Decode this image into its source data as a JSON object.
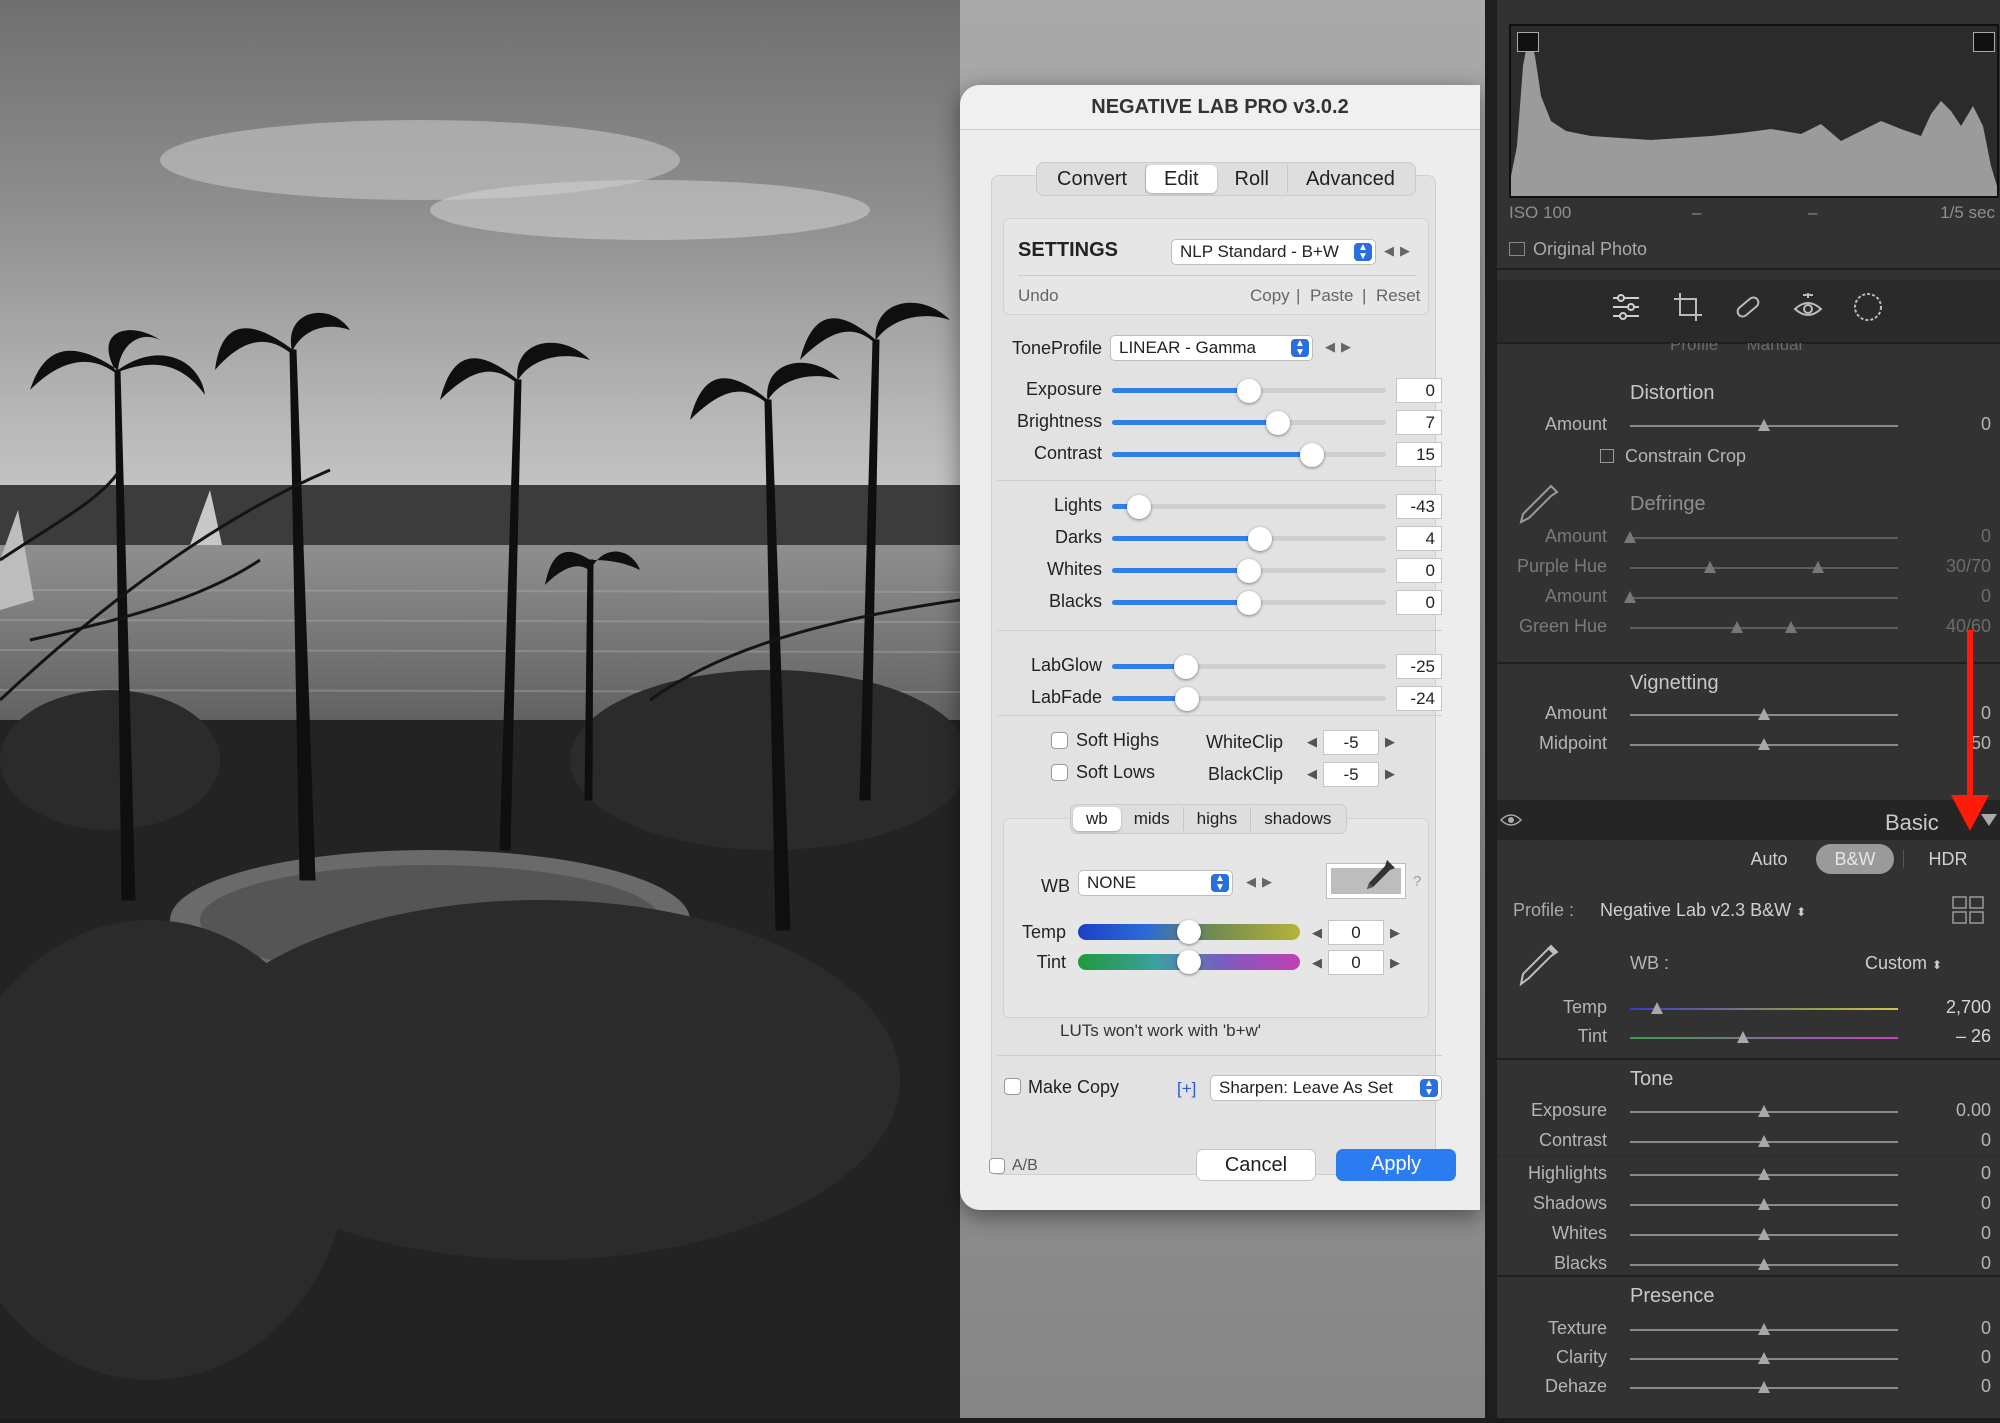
{
  "dialog": {
    "title": "NEGATIVE LAB PRO v3.0.2",
    "tabs": [
      "Convert",
      "Edit",
      "Roll",
      "Advanced"
    ],
    "active_tab": "Edit",
    "settings": {
      "heading": "SETTINGS",
      "preset": "NLP Standard - B+W",
      "undo": "Undo",
      "copy": "Copy",
      "paste": "Paste",
      "reset": "Reset",
      "sep": "|"
    },
    "tone_profile": {
      "label": "ToneProfile",
      "value": "LINEAR - Gamma"
    },
    "sliders": [
      {
        "label": "Exposure",
        "value": "0",
        "level": 0.5
      },
      {
        "label": "Brightness",
        "value": "7",
        "level": 0.605
      },
      {
        "label": "Contrast",
        "value": "15",
        "level": 0.73
      },
      {
        "label": "Lights",
        "value": "-43",
        "level": 0.1
      },
      {
        "label": "Darks",
        "value": "4",
        "level": 0.54
      },
      {
        "label": "Whites",
        "value": "0",
        "level": 0.5
      },
      {
        "label": "Blacks",
        "value": "0",
        "level": 0.5
      },
      {
        "label": "LabGlow",
        "value": "-25",
        "level": 0.27
      },
      {
        "label": "LabFade",
        "value": "-24",
        "level": 0.275
      }
    ],
    "soft_highs": "Soft Highs",
    "soft_lows": "Soft Lows",
    "white_clip": {
      "label": "WhiteClip",
      "value": "-5"
    },
    "black_clip": {
      "label": "BlackClip",
      "value": "-5"
    },
    "wb_tabs": [
      "wb",
      "mids",
      "highs",
      "shadows"
    ],
    "wb": {
      "label": "WB",
      "value": "NONE",
      "help": "?"
    },
    "temp": {
      "label": "Temp",
      "value": "0",
      "level": 0.5
    },
    "tint": {
      "label": "Tint",
      "value": "0",
      "level": 0.5
    },
    "lut_note": "LUTs won't work with 'b+w'",
    "make_copy": "Make Copy",
    "plus": "[+]",
    "sharpen": "Sharpen: Leave As Set",
    "ab": "A/B",
    "cancel": "Cancel",
    "apply": "Apply",
    "colors": {
      "accent": "#2f7fe6",
      "apply": "#2b7cf0"
    }
  },
  "lightroom": {
    "histogram": {
      "iso": "ISO 100",
      "dash1": "–",
      "dash2": "–",
      "shutter": "1/5 sec"
    },
    "original_photo": "Original Photo",
    "tools": [
      "sliders-icon",
      "crop-icon",
      "healing-icon",
      "redeye-icon",
      "masking-icon"
    ],
    "cut_text": "Profile      Manual",
    "distortion": {
      "title": "Distortion",
      "amount_label": "Amount",
      "amount_value": "0",
      "level": 0.5,
      "constrain": "Constrain Crop"
    },
    "defringe": {
      "title": "Defringe",
      "rows": [
        {
          "label": "Amount",
          "value": "0",
          "knobs": [
            0.0
          ]
        },
        {
          "label": "Purple Hue",
          "value": "30/70",
          "knobs": [
            0.3,
            0.7
          ]
        },
        {
          "label": "Amount",
          "value": "0",
          "knobs": [
            0.0
          ]
        },
        {
          "label": "Green Hue",
          "value": "40/60",
          "knobs": [
            0.4,
            0.6
          ]
        }
      ]
    },
    "vignetting": {
      "title": "Vignetting",
      "rows": [
        {
          "label": "Amount",
          "value": "0",
          "level": 0.5
        },
        {
          "label": "Midpoint",
          "value": "50",
          "level": 0.5
        }
      ]
    },
    "basic": {
      "title": "Basic",
      "auto": "Auto",
      "bw": "B&W",
      "hdr": "HDR",
      "profile_label": "Profile :",
      "profile_value": "Negative Lab v2.3 B&W",
      "wb_label": "WB :",
      "wb_value": "Custom",
      "temp": {
        "label": "Temp",
        "value": "2,700",
        "level": 0.1
      },
      "tint": {
        "label": "Tint",
        "value": "– 26",
        "level": 0.42
      },
      "tone_title": "Tone",
      "tone": [
        {
          "label": "Exposure",
          "value": "0.00",
          "level": 0.5
        },
        {
          "label": "Contrast",
          "value": "0",
          "level": 0.5
        },
        {
          "label": "Highlights",
          "value": "0",
          "level": 0.5
        },
        {
          "label": "Shadows",
          "value": "0",
          "level": 0.5
        },
        {
          "label": "Whites",
          "value": "0",
          "level": 0.5
        },
        {
          "label": "Blacks",
          "value": "0",
          "level": 0.5
        }
      ],
      "presence_title": "Presence",
      "presence": [
        {
          "label": "Texture",
          "value": "0",
          "level": 0.5
        },
        {
          "label": "Clarity",
          "value": "0",
          "level": 0.5
        },
        {
          "label": "Dehaze",
          "value": "0",
          "level": 0.5
        }
      ]
    },
    "colors": {
      "panel": "#323232",
      "annotation_arrow": "#ff1a0a"
    }
  }
}
